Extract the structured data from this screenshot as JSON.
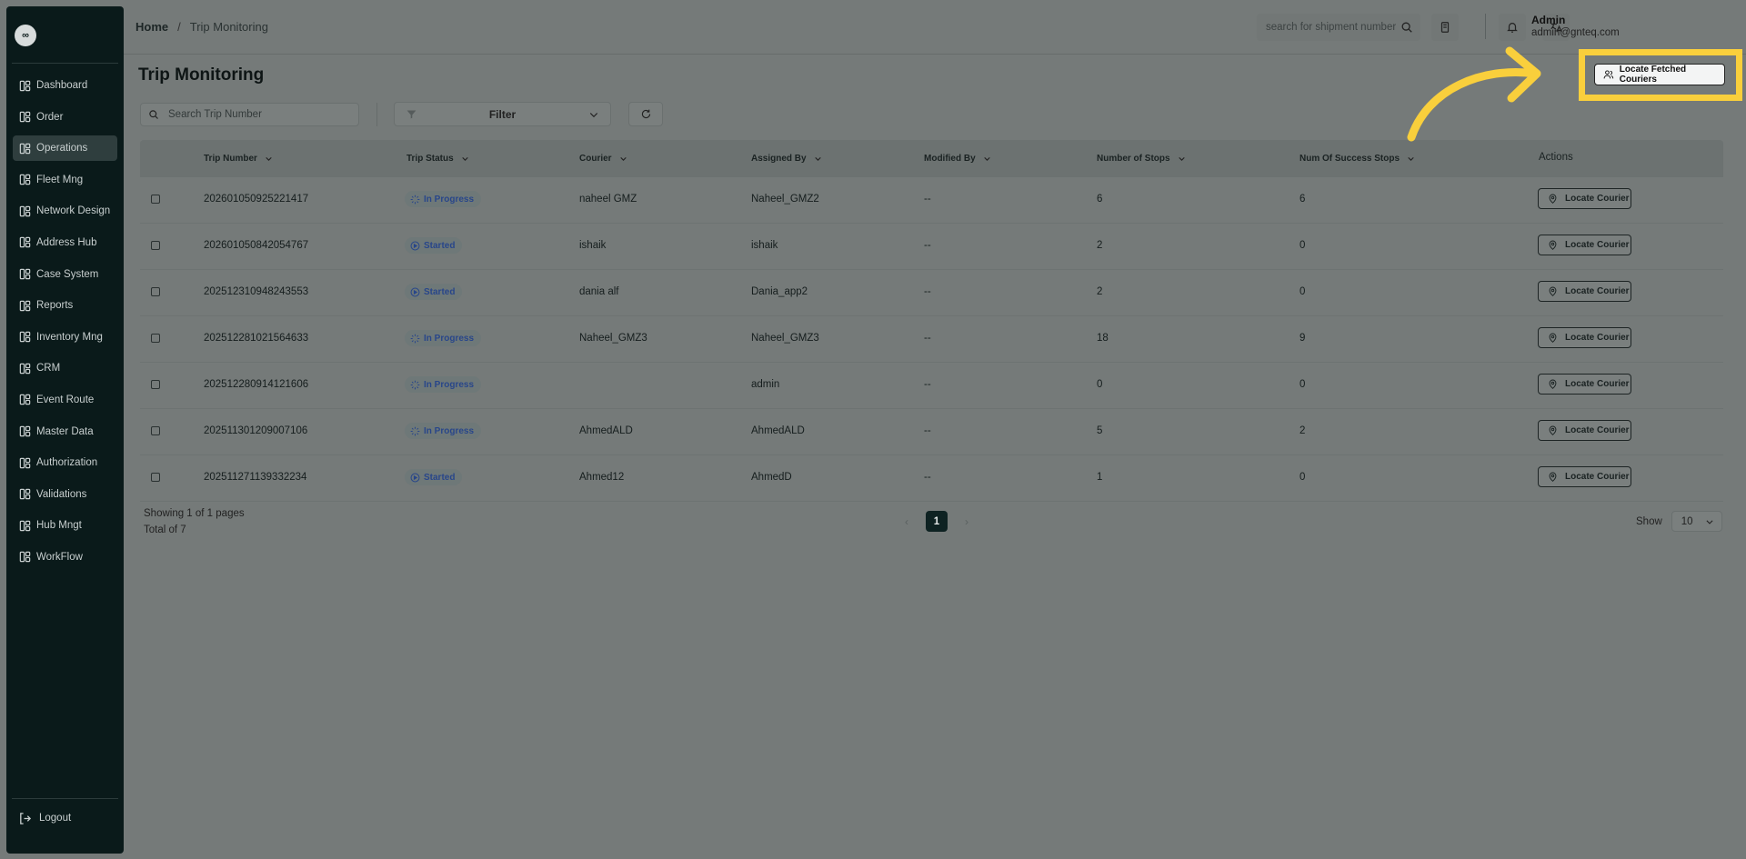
{
  "sidebar": {
    "logo": "∞",
    "items": [
      {
        "label": "Dashboard",
        "icon": "dashboard-icon"
      },
      {
        "label": "Order",
        "icon": "order-icon"
      },
      {
        "label": "Operations",
        "icon": "operations-icon",
        "active": true
      },
      {
        "label": "Fleet Mng",
        "icon": "truck-icon"
      },
      {
        "label": "Network Design",
        "icon": "network-icon"
      },
      {
        "label": "Address Hub",
        "icon": "address-icon"
      },
      {
        "label": "Case System",
        "icon": "case-icon"
      },
      {
        "label": "Reports",
        "icon": "reports-icon"
      },
      {
        "label": "Inventory Mng",
        "icon": "inventory-icon"
      },
      {
        "label": "CRM",
        "icon": "crm-icon"
      },
      {
        "label": "Event Route",
        "icon": "route-icon"
      },
      {
        "label": "Master Data",
        "icon": "database-icon"
      },
      {
        "label": "Authorization",
        "icon": "user-key-icon"
      },
      {
        "label": "Validations",
        "icon": "validations-icon"
      },
      {
        "label": "Hub Mngt",
        "icon": "hub-icon"
      },
      {
        "label": "WorkFlow",
        "icon": "workflow-icon"
      }
    ],
    "logout": "Logout"
  },
  "header": {
    "breadcrumb_home": "Home",
    "breadcrumb_sep": "/",
    "breadcrumb_current": "Trip Monitoring",
    "search_placeholder": "search for shipment number",
    "user_name": "Admin",
    "user_email": "admin@gnteq.com"
  },
  "page": {
    "title": "Trip Monitoring",
    "search_placeholder": "Search Trip Number",
    "filter_label": "Filter",
    "locate_fetched_label": "Locate Fetched Couriers"
  },
  "table": {
    "columns": [
      "Trip Number",
      "Trip Status",
      "Courier",
      "Assigned By",
      "Modified By",
      "Number of Stops",
      "Num Of Success Stops",
      "Actions"
    ],
    "action_label": "Locate Courier",
    "rows": [
      {
        "trip": "202601050925221417",
        "status": "In Progress",
        "courier": "naheel GMZ",
        "assigned": "Naheel_GMZ2",
        "modified": "--",
        "stops": "6",
        "success": "6"
      },
      {
        "trip": "202601050842054767",
        "status": "Started",
        "courier": "ishaik",
        "assigned": "ishaik",
        "modified": "--",
        "stops": "2",
        "success": "0"
      },
      {
        "trip": "202512310948243553",
        "status": "Started",
        "courier": "dania alf",
        "assigned": "Dania_app2",
        "modified": "--",
        "stops": "2",
        "success": "0"
      },
      {
        "trip": "202512281021564633",
        "status": "In Progress",
        "courier": "Naheel_GMZ3",
        "assigned": "Naheel_GMZ3",
        "modified": "--",
        "stops": "18",
        "success": "9"
      },
      {
        "trip": "202512280914121606",
        "status": "In Progress",
        "courier": "",
        "assigned": "admin",
        "modified": "--",
        "stops": "0",
        "success": "0"
      },
      {
        "trip": "202511301209007106",
        "status": "In Progress",
        "courier": "AhmedALD",
        "assigned": "AhmedALD",
        "modified": "--",
        "stops": "5",
        "success": "2"
      },
      {
        "trip": "202511271139332234",
        "status": "Started",
        "courier": "Ahmed12",
        "assigned": "AhmedD",
        "modified": "--",
        "stops": "1",
        "success": "0"
      }
    ]
  },
  "footer": {
    "showing": "Showing 1 of 1 pages",
    "total": "Total of 7",
    "page": "1",
    "show_label": "Show",
    "page_size": "10"
  },
  "colors": {
    "highlight": "#f9cf3c",
    "sidebar_bg": "#0a1a1a",
    "status_text": "#28468a"
  }
}
